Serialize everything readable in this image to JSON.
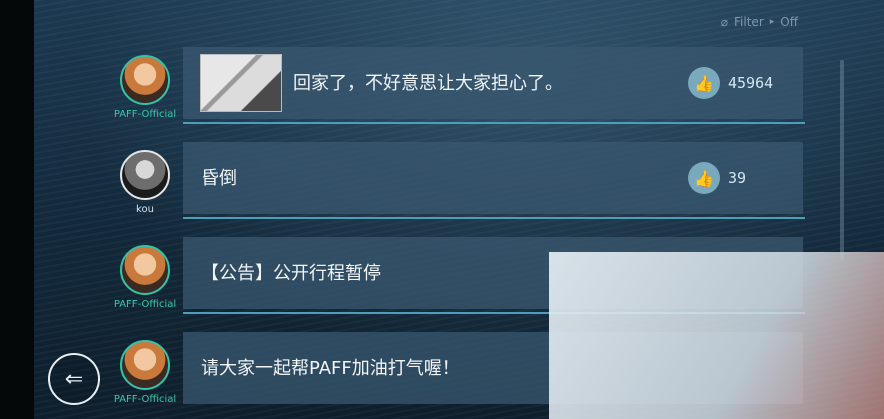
{
  "header": {
    "filter_label": "Filter",
    "filter_arrow": "▸",
    "filter_value": "Off",
    "filter_icon": "eye-off-icon"
  },
  "posts": [
    {
      "username": "PAFF-Official",
      "avatar": "paff-avatar",
      "text": "回家了，不好意思让大家担心了。",
      "has_image": true,
      "like_icon": "👍",
      "likes": "45964"
    },
    {
      "username": "kou",
      "avatar": "kou-avatar",
      "text": "昏倒",
      "has_image": false,
      "like_icon": "👍",
      "likes": "39"
    },
    {
      "username": "PAFF-Official",
      "avatar": "paff-avatar",
      "text": "【公告】公开行程暂停",
      "has_image": false
    },
    {
      "username": "PAFF-Official",
      "avatar": "paff-avatar",
      "text": "请大家一起帮PAFF加油打气喔！",
      "has_image": false
    }
  ],
  "nav": {
    "back_icon": "⇐"
  },
  "colors": {
    "accent": "#35c9a8",
    "card_bg": "#3a5870",
    "card_line": "#4f9db8"
  }
}
